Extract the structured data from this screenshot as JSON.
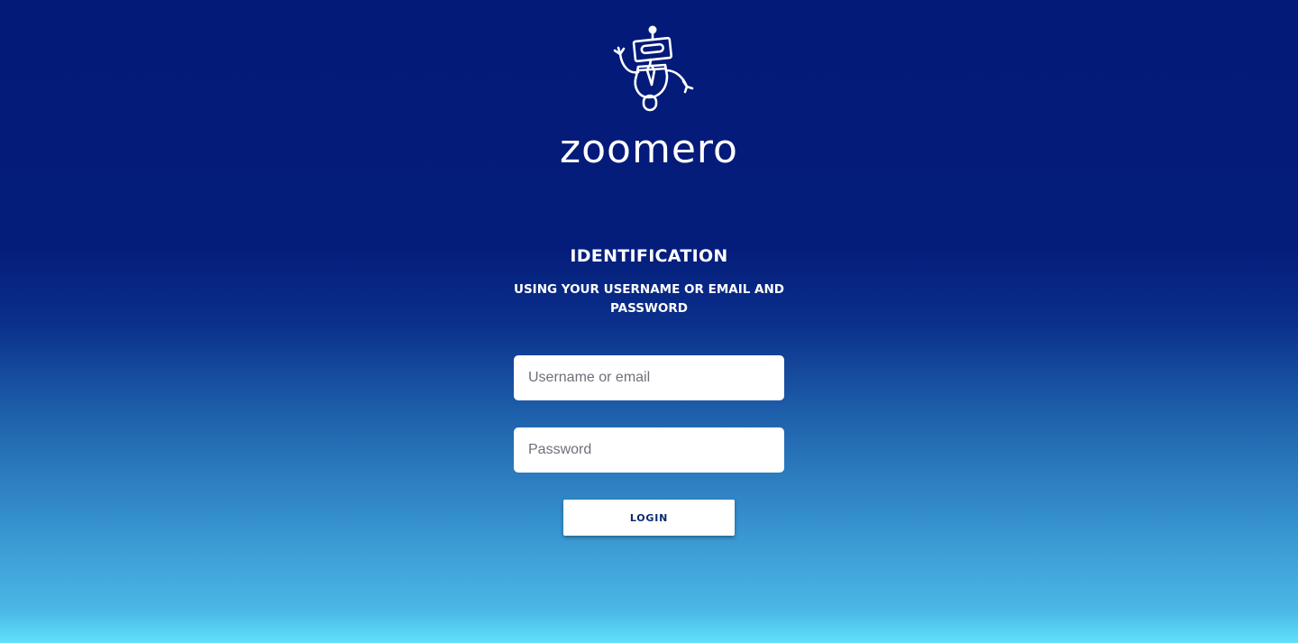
{
  "brand": {
    "logo_icon": "robot-icon",
    "name": "zoomero"
  },
  "login": {
    "heading": "IDENTIFICATION",
    "subheading": "USING YOUR USERNAME OR EMAIL AND PASSWORD",
    "username": {
      "placeholder": "Username or email",
      "value": ""
    },
    "password": {
      "placeholder": "Password",
      "value": ""
    },
    "login_label": "LOGIN"
  },
  "colors": {
    "background_top": "#031a78",
    "background_bottom": "#5fe0fb",
    "text": "#ffffff",
    "button_text": "#0a2a6e"
  }
}
